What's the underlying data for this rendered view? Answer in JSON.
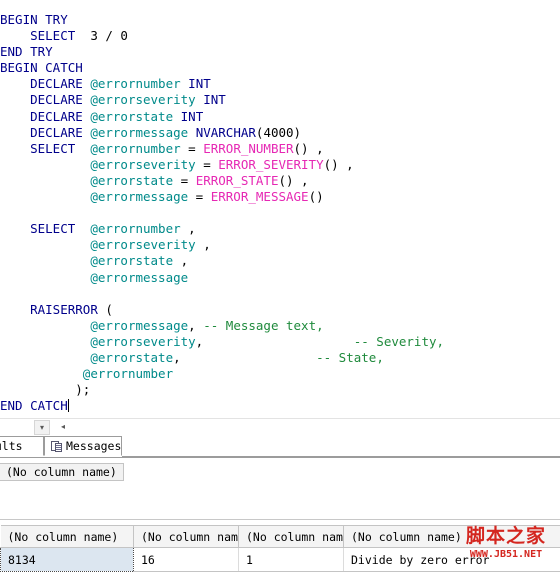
{
  "editor": {
    "name": "sql-query-editor",
    "language": "T-SQL",
    "caret_line": "END CATCH",
    "code_lines": [
      {
        "indent": 0,
        "segments": [
          {
            "t": "BEGIN TRY",
            "c": "kw"
          }
        ]
      },
      {
        "indent": 4,
        "segments": [
          {
            "t": "SELECT",
            "c": "kw"
          },
          {
            "t": "  3 / 0",
            "c": "plain"
          }
        ]
      },
      {
        "indent": 0,
        "segments": [
          {
            "t": "END TRY",
            "c": "kw"
          }
        ]
      },
      {
        "indent": 0,
        "segments": [
          {
            "t": "BEGIN CATCH",
            "c": "kw"
          }
        ]
      },
      {
        "indent": 4,
        "segments": [
          {
            "t": "DECLARE ",
            "c": "kw"
          },
          {
            "t": "@errornumber",
            "c": "var"
          },
          {
            "t": " ",
            "c": "plain"
          },
          {
            "t": "INT",
            "c": "kw"
          }
        ]
      },
      {
        "indent": 4,
        "segments": [
          {
            "t": "DECLARE ",
            "c": "kw"
          },
          {
            "t": "@errorseverity",
            "c": "var"
          },
          {
            "t": " ",
            "c": "plain"
          },
          {
            "t": "INT",
            "c": "kw"
          }
        ]
      },
      {
        "indent": 4,
        "segments": [
          {
            "t": "DECLARE ",
            "c": "kw"
          },
          {
            "t": "@errorstate",
            "c": "var"
          },
          {
            "t": " ",
            "c": "plain"
          },
          {
            "t": "INT",
            "c": "kw"
          }
        ]
      },
      {
        "indent": 4,
        "segments": [
          {
            "t": "DECLARE ",
            "c": "kw"
          },
          {
            "t": "@errormessage",
            "c": "var"
          },
          {
            "t": " ",
            "c": "plain"
          },
          {
            "t": "NVARCHAR",
            "c": "kw"
          },
          {
            "t": "(4000)",
            "c": "plain"
          }
        ]
      },
      {
        "indent": 4,
        "segments": [
          {
            "t": "SELECT",
            "c": "kw"
          },
          {
            "t": "  ",
            "c": "plain"
          },
          {
            "t": "@errornumber",
            "c": "var"
          },
          {
            "t": " = ",
            "c": "plain"
          },
          {
            "t": "ERROR_NUMBER",
            "c": "fn"
          },
          {
            "t": "() ,",
            "c": "plain"
          }
        ]
      },
      {
        "indent": 12,
        "segments": [
          {
            "t": "@errorseverity",
            "c": "var"
          },
          {
            "t": " = ",
            "c": "plain"
          },
          {
            "t": "ERROR_SEVERITY",
            "c": "fn"
          },
          {
            "t": "() ,",
            "c": "plain"
          }
        ]
      },
      {
        "indent": 12,
        "segments": [
          {
            "t": "@errorstate",
            "c": "var"
          },
          {
            "t": " = ",
            "c": "plain"
          },
          {
            "t": "ERROR_STATE",
            "c": "fn"
          },
          {
            "t": "() ,",
            "c": "plain"
          }
        ]
      },
      {
        "indent": 12,
        "segments": [
          {
            "t": "@errormessage",
            "c": "var"
          },
          {
            "t": " = ",
            "c": "plain"
          },
          {
            "t": "ERROR_MESSAGE",
            "c": "fn"
          },
          {
            "t": "()",
            "c": "plain"
          }
        ]
      },
      {
        "indent": 0,
        "segments": []
      },
      {
        "indent": 4,
        "segments": [
          {
            "t": "SELECT",
            "c": "kw"
          },
          {
            "t": "  ",
            "c": "plain"
          },
          {
            "t": "@errornumber",
            "c": "var"
          },
          {
            "t": " ,",
            "c": "plain"
          }
        ]
      },
      {
        "indent": 12,
        "segments": [
          {
            "t": "@errorseverity",
            "c": "var"
          },
          {
            "t": " ,",
            "c": "plain"
          }
        ]
      },
      {
        "indent": 12,
        "segments": [
          {
            "t": "@errorstate",
            "c": "var"
          },
          {
            "t": " ,",
            "c": "plain"
          }
        ]
      },
      {
        "indent": 12,
        "segments": [
          {
            "t": "@errormessage",
            "c": "var"
          }
        ]
      },
      {
        "indent": 0,
        "segments": []
      },
      {
        "indent": 4,
        "segments": [
          {
            "t": "RAISERROR",
            "c": "kw"
          },
          {
            "t": " (",
            "c": "plain"
          }
        ]
      },
      {
        "indent": 12,
        "segments": [
          {
            "t": "@errormessage",
            "c": "var"
          },
          {
            "t": ", ",
            "c": "plain"
          },
          {
            "t": "-- Message text,",
            "c": "cmt"
          }
        ]
      },
      {
        "indent": 12,
        "segments": [
          {
            "t": "@errorseverity",
            "c": "var"
          },
          {
            "t": ",",
            "c": "plain"
          },
          {
            "t": "                    ",
            "c": "plain"
          },
          {
            "t": "-- Severity,",
            "c": "cmt"
          }
        ]
      },
      {
        "indent": 12,
        "segments": [
          {
            "t": "@errorstate",
            "c": "var"
          },
          {
            "t": ",",
            "c": "plain"
          },
          {
            "t": "                  ",
            "c": "plain"
          },
          {
            "t": "-- State,",
            "c": "cmt"
          }
        ]
      },
      {
        "indent": 11,
        "segments": [
          {
            "t": "@errornumber",
            "c": "var"
          }
        ]
      },
      {
        "indent": 10,
        "segments": [
          {
            "t": ");",
            "c": "plain"
          }
        ]
      },
      {
        "indent": 0,
        "segments": [
          {
            "t": "END CATCH",
            "c": "kw"
          },
          {
            "t": "@@CARET@@",
            "c": "caret"
          }
        ]
      }
    ],
    "colors": {
      "keyword": "#00008b",
      "variable": "#008a8a",
      "function": "#e628b4",
      "comment": "#1f8a3c",
      "plain": "#000000",
      "background": "#ffffff"
    }
  },
  "strip": {
    "dropdown_glyph": "▾",
    "left_arrow_glyph": "◂"
  },
  "tabs": {
    "results": {
      "label": "esults",
      "full_label": "Results",
      "selected": true
    },
    "messages": {
      "label": "Messages",
      "icon": "grid-icon",
      "selected": false
    }
  },
  "results_panel": {
    "columns": [
      "(No column name)"
    ]
  },
  "grid": {
    "columns": [
      "(No column name)",
      "(No column name)",
      "(No column name)",
      "(No column name)"
    ],
    "rows": [
      [
        "8134",
        "16",
        "1",
        "Divide by zero error"
      ]
    ],
    "selected_cell": {
      "row": 0,
      "col": 0
    }
  },
  "watermark": {
    "cn": "脚本之家",
    "url": "WWW.JB51.NET",
    "color": "#d4261f"
  }
}
